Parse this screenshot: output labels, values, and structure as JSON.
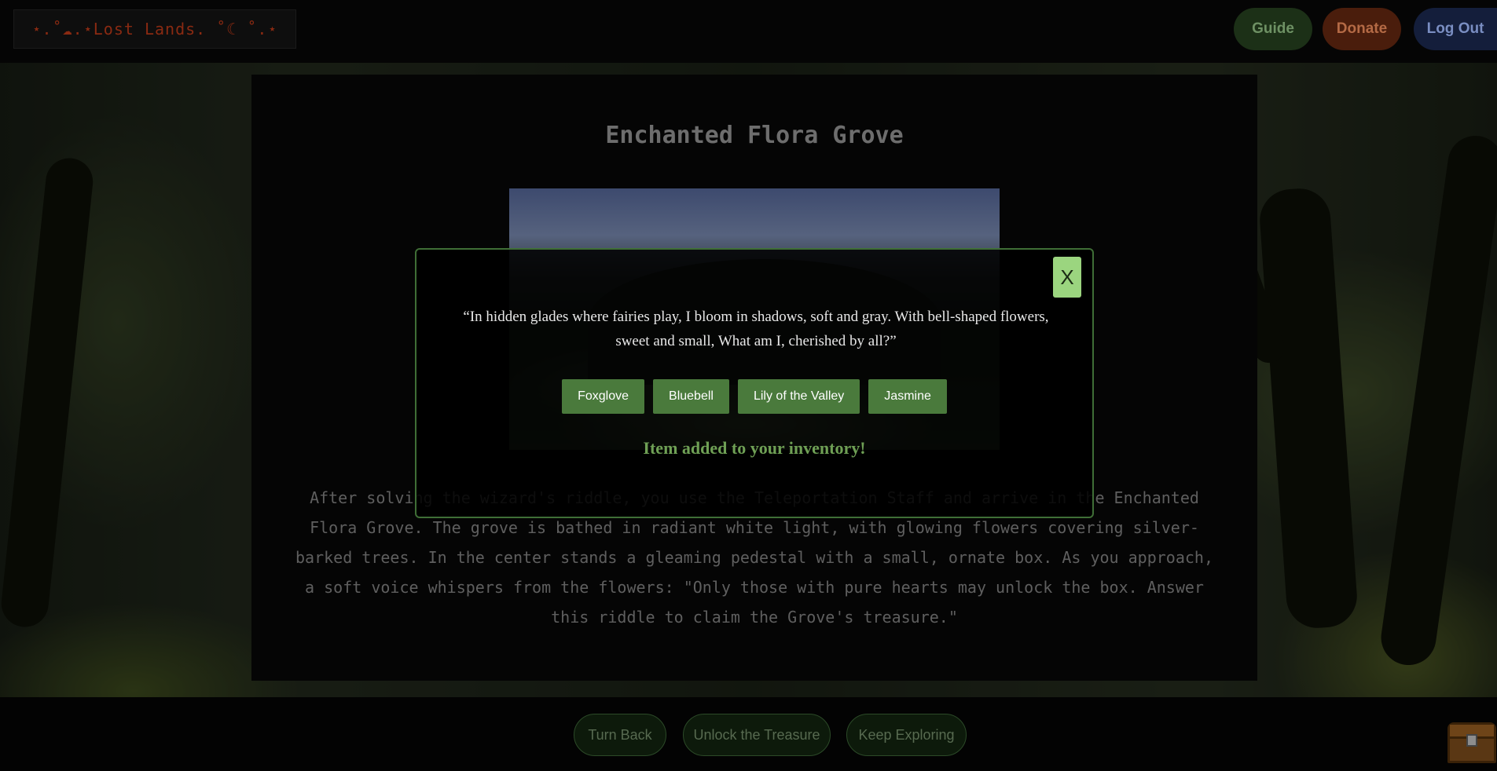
{
  "header": {
    "logo_text": "⋆.˚☁︎.⋆Lost Lands. ˚☾ ˚.⋆",
    "nav": {
      "guide": "Guide",
      "donate": "Donate",
      "logout": "Log Out"
    }
  },
  "location": {
    "title": "Enchanted Flora Grove",
    "story": "After solving the wizard's riddle, you use the Teleportation Staff and arrive in the Enchanted Flora Grove. The grove is bathed in radiant white light, with glowing flowers covering silver-barked trees. In the center stands a gleaming pedestal with a small, ornate box. As you approach, a soft voice whispers from the flowers: \"Only those with pure hearts may unlock the box. Answer this riddle to claim the Grove's treasure.\""
  },
  "modal": {
    "close_label": "X",
    "riddle": "“In hidden glades where fairies play, I bloom in shadows, soft and gray. With bell-shaped flowers, sweet and small, What am I, cherished by all?”",
    "answers": [
      "Foxglove",
      "Bluebell",
      "Lily of the Valley",
      "Jasmine"
    ],
    "message": "Item added to your inventory!"
  },
  "choices": {
    "turn_back": "Turn Back",
    "unlock": "Unlock the Treasure",
    "keep_exploring": "Keep Exploring"
  },
  "icons": {
    "inventory": "treasure-chest-icon"
  },
  "colors": {
    "accent_green": "#4a7a3c",
    "message_green": "#6fa055",
    "close_button": "#9bd57f",
    "logo": "#8a2a12"
  }
}
